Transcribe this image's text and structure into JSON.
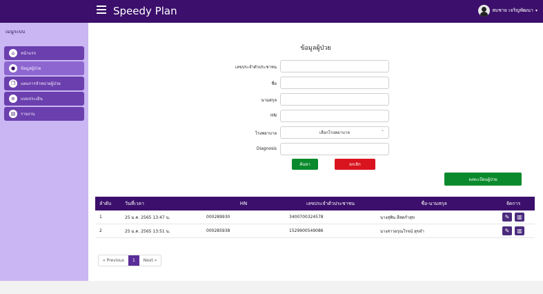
{
  "header": {
    "brand": "Speedy Plan",
    "user_name": "สมชาย เจริญพัฒนา",
    "caret": "▾"
  },
  "sidebar": {
    "title": "เมนูระบบ",
    "items": [
      {
        "label": "หน้าแรก",
        "icon": "home-icon",
        "glyph": "⌂"
      },
      {
        "label": "ข้อมูลผู้ป่วย",
        "icon": "user-icon",
        "glyph": "●"
      },
      {
        "label": "แผนการจำหน่ายผู้ป่วย",
        "icon": "copy-icon",
        "glyph": "❐"
      },
      {
        "label": "แบบประเมิน",
        "icon": "list-icon",
        "glyph": "≡"
      },
      {
        "label": "รายงาน",
        "icon": "file-icon",
        "glyph": "▤"
      }
    ]
  },
  "form": {
    "title": "ข้อมูลผู้ป่วย",
    "fields": [
      {
        "label": "เลขประจำตัวประชาชน",
        "value": ""
      },
      {
        "label": "ชื่อ",
        "value": ""
      },
      {
        "label": "นามสกุล",
        "value": ""
      },
      {
        "label": "HN",
        "value": ""
      },
      {
        "label": "โรงพยาบาล",
        "value": "เลือกโรงพยาบาล"
      },
      {
        "label": "Diagnosis",
        "value": ""
      }
    ],
    "save_label": "ค้นหา",
    "cancel_label": "ยกเลิก",
    "register_label": "ลงทะเบียนผู้ป่วย"
  },
  "table": {
    "headers": [
      "ลำดับ",
      "วันที่เวลา",
      "HN",
      "เลขประจำตัวประชาชน",
      "ชื่อ-นามสกุล",
      "จัดการ"
    ],
    "rows": [
      {
        "no": "1",
        "datetime": "25 ม.ค. 2565 13:47 น.",
        "hn": "000289930",
        "id": "3400700324578",
        "name": "นางสุพิน สีสดกำสุข"
      },
      {
        "no": "2",
        "datetime": "25 ม.ค. 2565 13:51 น.",
        "hn": "000285938",
        "id": "1529900549086",
        "name": "นางสาวอรุณโรจน์ สุขจำ"
      }
    ]
  },
  "pagination": {
    "prev": "« Previous",
    "current": "1",
    "next": "Next »"
  },
  "colors": {
    "topbar": "#3b0f6b",
    "sidebar": "#c9b6f2",
    "accent_green": "#0a8a2c",
    "accent_red": "#d9141f"
  }
}
